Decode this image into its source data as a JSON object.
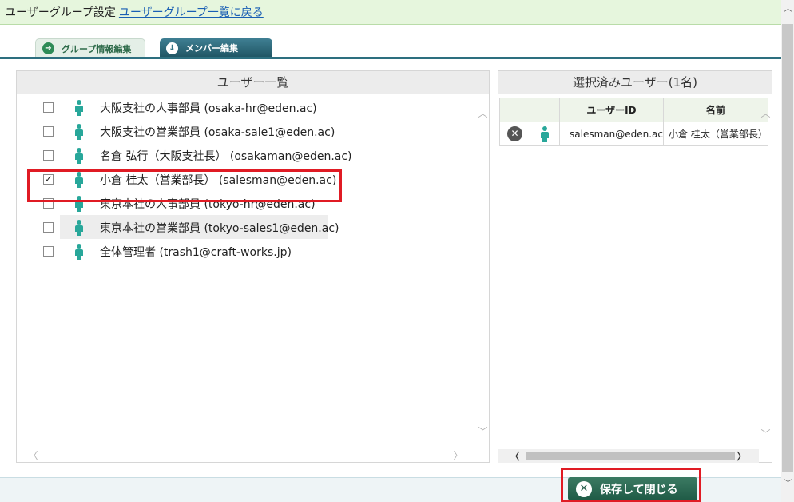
{
  "header": {
    "title": "ユーザーグループ設定",
    "back_link": "ユーザーグループ一覧に戻る"
  },
  "tabs": [
    {
      "label": "グループ情報編集",
      "icon": "arrow-right-icon",
      "active": false
    },
    {
      "label": "メンバー編集",
      "icon": "arrow-down-icon",
      "active": true
    }
  ],
  "user_panel": {
    "title": "ユーザー一覧",
    "users": [
      {
        "label": "大阪支社の人事部員 (osaka-hr@eden.ac)",
        "checked": false
      },
      {
        "label": "大阪支社の営業部員 (osaka-sale1@eden.ac)",
        "checked": false
      },
      {
        "label": "名倉 弘行（大阪支社長） (osakaman@eden.ac)",
        "checked": false
      },
      {
        "label": "小倉 桂太（営業部長） (salesman@eden.ac)",
        "checked": true
      },
      {
        "label": "東京本社の人事部員 (tokyo-hr@eden.ac)",
        "checked": false
      },
      {
        "label": "東京本社の営業部員 (tokyo-sales1@eden.ac)",
        "checked": false
      },
      {
        "label": "全体管理者 (trash1@craft-works.jp)",
        "checked": false
      }
    ]
  },
  "selected_panel": {
    "title": "選択済みユーザー(1名)",
    "columns": [
      "",
      "",
      "ユーザーID",
      "名前"
    ],
    "rows": [
      {
        "user_id": "salesman@eden.ac",
        "name": "小倉 桂太（営業部長）"
      }
    ]
  },
  "footer": {
    "save_label": "保存して閉じる"
  },
  "colors": {
    "header_bg": "#e6f6dd",
    "accent": "#2d6f7f",
    "highlight_red": "#e01b24",
    "person_icon": "#28a79a"
  }
}
